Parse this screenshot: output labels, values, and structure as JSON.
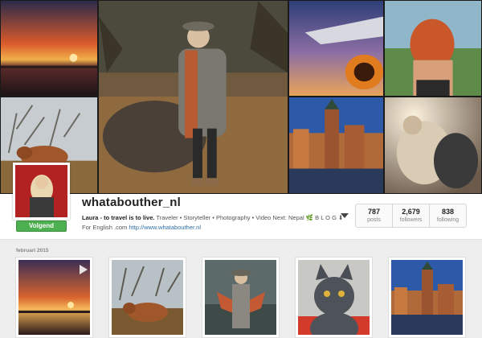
{
  "profile": {
    "username": "whatabouther_nl",
    "follow_label": "Volgend",
    "bio_name": "Laura - to travel is to live.",
    "bio_text": " Traveler • Storyteller • Photography • Video Next: Nepal 🌿 B L O G ⬇ For English .com ",
    "bio_link": "http://www.whatabouther.nl"
  },
  "stats": [
    {
      "value": "787",
      "label": "posts"
    },
    {
      "value": "2,679",
      "label": "followers"
    },
    {
      "value": "838",
      "label": "following"
    }
  ],
  "feed": {
    "month_label": "februari 2015"
  },
  "icons": {
    "more": "chevron-down-icon",
    "video": "play-icon"
  },
  "colors": {
    "follow_green": "#4caf50",
    "link_blue": "#2f6ea5"
  }
}
